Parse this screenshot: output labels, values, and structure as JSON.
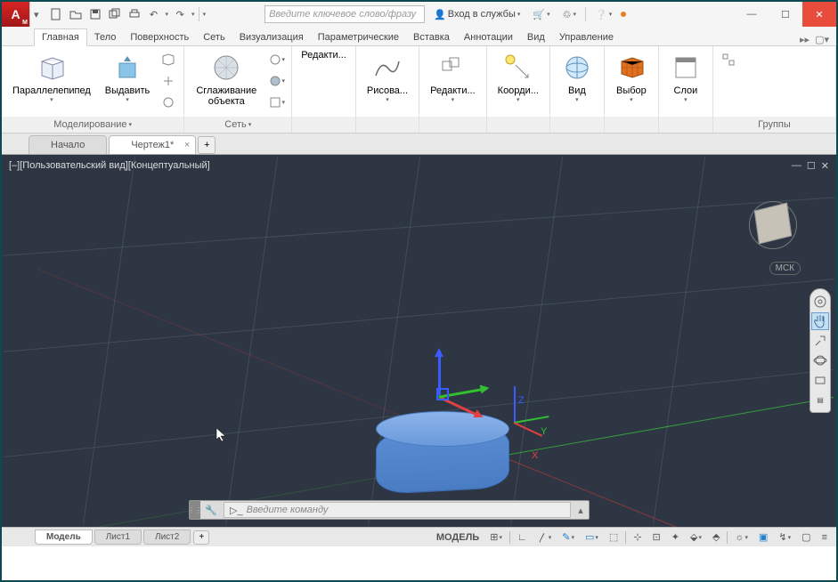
{
  "titlebar": {
    "search_placeholder": "Введите ключевое слово/фразу",
    "signin_label": "Вход в службы"
  },
  "ribbon_tabs": [
    "Главная",
    "Тело",
    "Поверхность",
    "Сеть",
    "Визуализация",
    "Параметрические",
    "Вставка",
    "Аннотации",
    "Вид",
    "Управление"
  ],
  "active_ribbon_tab": 0,
  "ribbon": {
    "panel_modeling": "Моделирование",
    "panel_mesh": "Сеть",
    "btn_box": "Параллелепипед",
    "btn_extrude": "Выдавить",
    "btn_smooth": "Сглаживание объекта",
    "btn_edit": "Редакти...",
    "btn_draw": "Рисова...",
    "btn_modify": "Редакти...",
    "btn_coord": "Коорди...",
    "btn_view": "Вид",
    "btn_selection": "Выбор",
    "btn_layers": "Слои",
    "btn_groups": "Группы"
  },
  "doc_tabs": {
    "items": [
      "Начало",
      "Чертеж1*"
    ],
    "active": 1
  },
  "viewport": {
    "label": "[–][Пользовательский вид][Концептуальный]",
    "wcs": "МСК",
    "axes": {
      "x": "X",
      "y": "Y",
      "z": "Z"
    }
  },
  "command": {
    "placeholder": "Введите команду",
    "prompt": "▷_"
  },
  "layout_tabs": [
    "Модель",
    "Лист1",
    "Лист2"
  ],
  "status": {
    "model": "МОДЕЛЬ"
  }
}
